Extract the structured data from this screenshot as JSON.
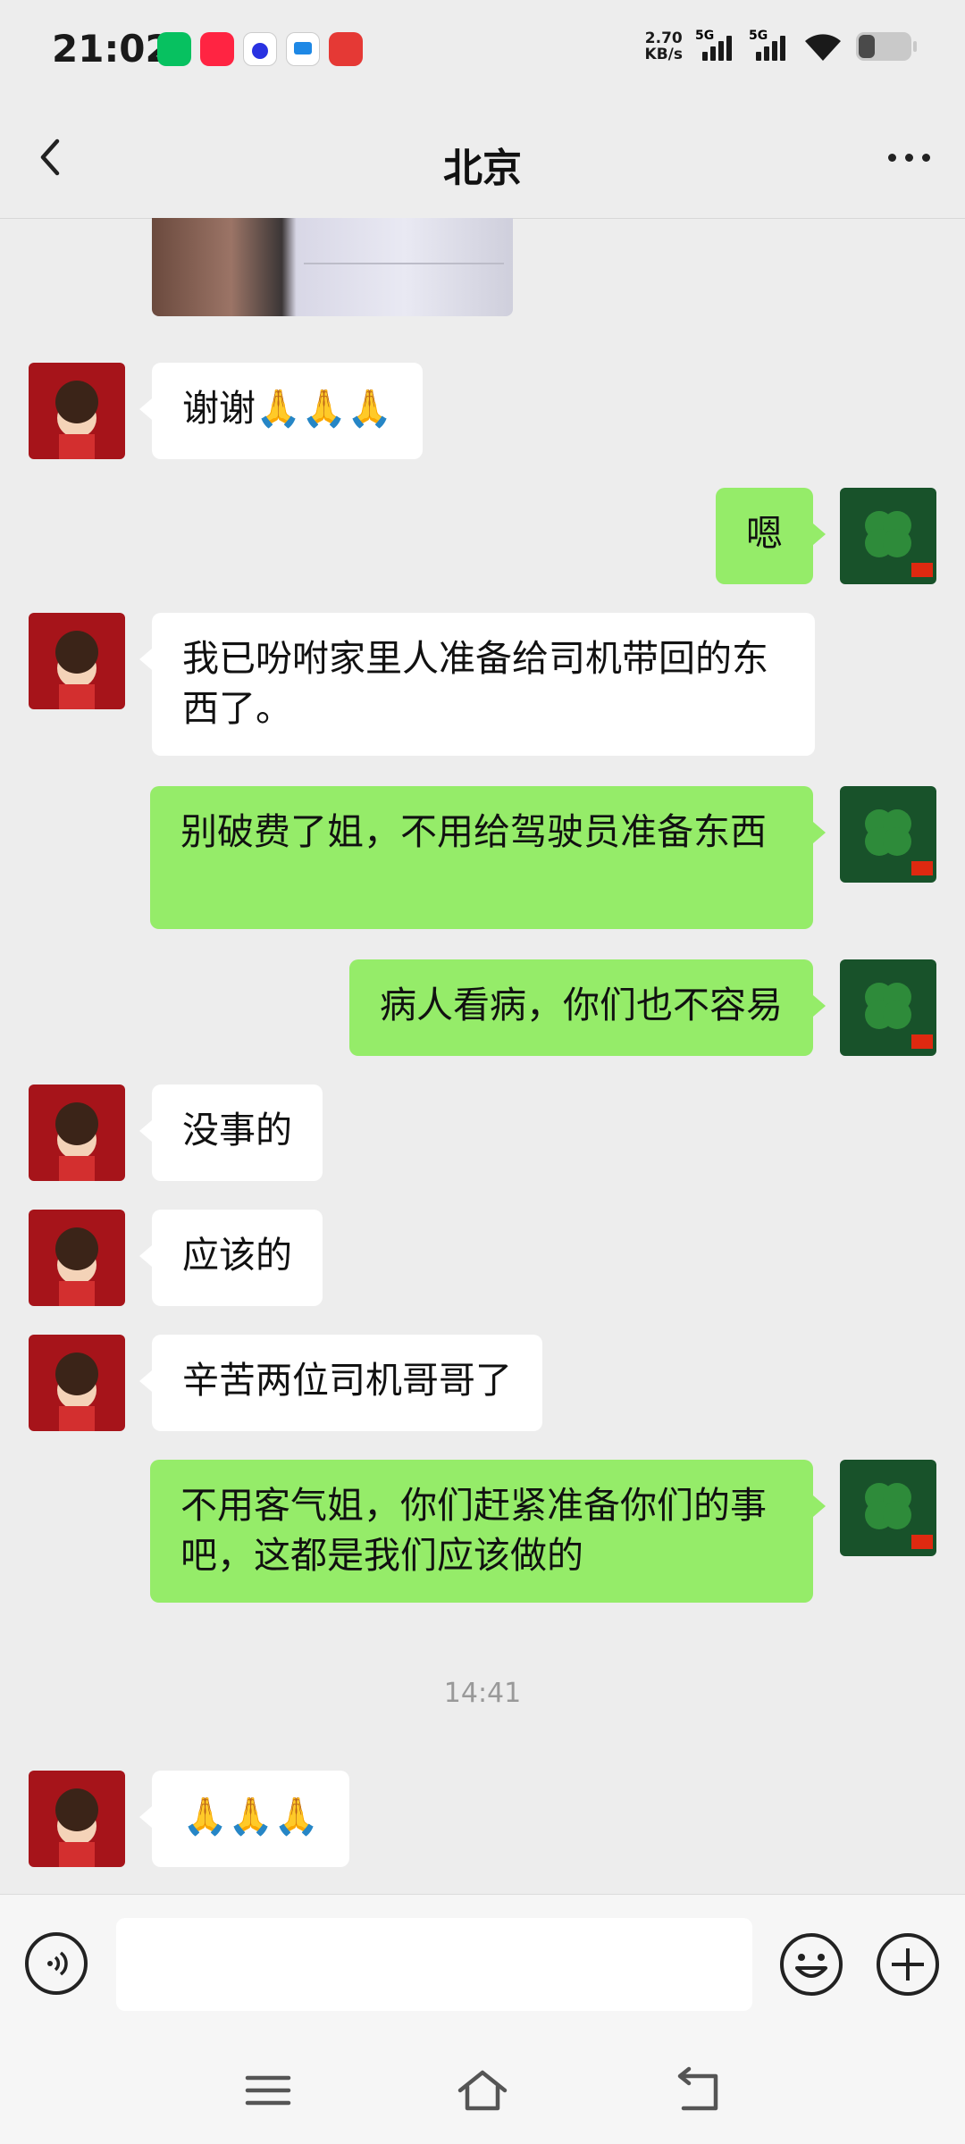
{
  "status_bar": {
    "time": "21:02",
    "net_speed_value": "2.70",
    "net_speed_unit": "KB/s",
    "signal1_label": "5G",
    "signal2_label": "5G",
    "app_icons": [
      "wechat-icon",
      "xiaohongshu-icon",
      "baidu-icon",
      "app-icon",
      "game-icon"
    ],
    "battery_level": 0.25
  },
  "header": {
    "title": "北京"
  },
  "messages": [
    {
      "side": "left",
      "text": "谢谢🙏🙏🙏"
    },
    {
      "side": "right",
      "text": "嗯"
    },
    {
      "side": "left",
      "text": "我已吩咐家里人准备给司机带回的东西了。"
    },
    {
      "side": "right",
      "text": "别破费了姐，不用给驾驶员准备东西"
    },
    {
      "side": "right",
      "text": "病人看病，你们也不容易"
    },
    {
      "side": "left",
      "text": "没事的"
    },
    {
      "side": "left",
      "text": "应该的"
    },
    {
      "side": "left",
      "text": "辛苦两位司机哥哥了"
    },
    {
      "side": "right",
      "text": "不用客气姐，你们赶紧准备你们的事吧，这都是我们应该做的"
    },
    {
      "side": "left",
      "text": "🙏🙏🙏"
    }
  ],
  "time_separator": "14:41",
  "input": {
    "placeholder": ""
  },
  "colors": {
    "background": "#ededed",
    "bubble_self": "#95ec69",
    "bubble_other": "#ffffff"
  }
}
